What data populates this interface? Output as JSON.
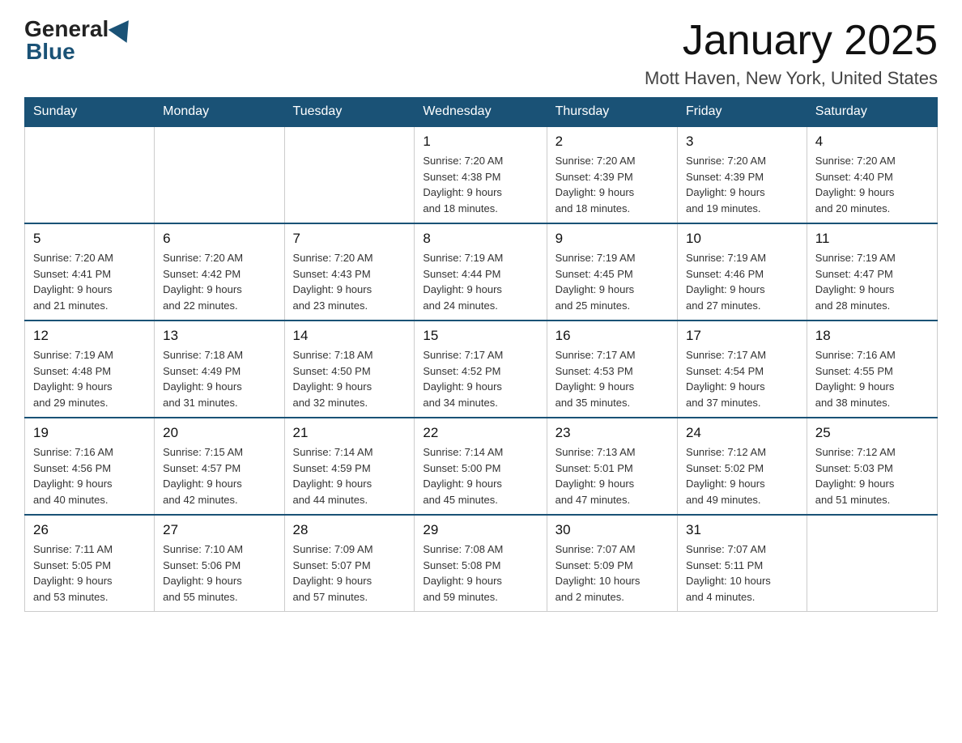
{
  "header": {
    "logo_general": "General",
    "logo_blue": "Blue",
    "month_title": "January 2025",
    "location": "Mott Haven, New York, United States"
  },
  "days_of_week": [
    "Sunday",
    "Monday",
    "Tuesday",
    "Wednesday",
    "Thursday",
    "Friday",
    "Saturday"
  ],
  "weeks": [
    [
      {
        "day": "",
        "info": ""
      },
      {
        "day": "",
        "info": ""
      },
      {
        "day": "",
        "info": ""
      },
      {
        "day": "1",
        "info": "Sunrise: 7:20 AM\nSunset: 4:38 PM\nDaylight: 9 hours\nand 18 minutes."
      },
      {
        "day": "2",
        "info": "Sunrise: 7:20 AM\nSunset: 4:39 PM\nDaylight: 9 hours\nand 18 minutes."
      },
      {
        "day": "3",
        "info": "Sunrise: 7:20 AM\nSunset: 4:39 PM\nDaylight: 9 hours\nand 19 minutes."
      },
      {
        "day": "4",
        "info": "Sunrise: 7:20 AM\nSunset: 4:40 PM\nDaylight: 9 hours\nand 20 minutes."
      }
    ],
    [
      {
        "day": "5",
        "info": "Sunrise: 7:20 AM\nSunset: 4:41 PM\nDaylight: 9 hours\nand 21 minutes."
      },
      {
        "day": "6",
        "info": "Sunrise: 7:20 AM\nSunset: 4:42 PM\nDaylight: 9 hours\nand 22 minutes."
      },
      {
        "day": "7",
        "info": "Sunrise: 7:20 AM\nSunset: 4:43 PM\nDaylight: 9 hours\nand 23 minutes."
      },
      {
        "day": "8",
        "info": "Sunrise: 7:19 AM\nSunset: 4:44 PM\nDaylight: 9 hours\nand 24 minutes."
      },
      {
        "day": "9",
        "info": "Sunrise: 7:19 AM\nSunset: 4:45 PM\nDaylight: 9 hours\nand 25 minutes."
      },
      {
        "day": "10",
        "info": "Sunrise: 7:19 AM\nSunset: 4:46 PM\nDaylight: 9 hours\nand 27 minutes."
      },
      {
        "day": "11",
        "info": "Sunrise: 7:19 AM\nSunset: 4:47 PM\nDaylight: 9 hours\nand 28 minutes."
      }
    ],
    [
      {
        "day": "12",
        "info": "Sunrise: 7:19 AM\nSunset: 4:48 PM\nDaylight: 9 hours\nand 29 minutes."
      },
      {
        "day": "13",
        "info": "Sunrise: 7:18 AM\nSunset: 4:49 PM\nDaylight: 9 hours\nand 31 minutes."
      },
      {
        "day": "14",
        "info": "Sunrise: 7:18 AM\nSunset: 4:50 PM\nDaylight: 9 hours\nand 32 minutes."
      },
      {
        "day": "15",
        "info": "Sunrise: 7:17 AM\nSunset: 4:52 PM\nDaylight: 9 hours\nand 34 minutes."
      },
      {
        "day": "16",
        "info": "Sunrise: 7:17 AM\nSunset: 4:53 PM\nDaylight: 9 hours\nand 35 minutes."
      },
      {
        "day": "17",
        "info": "Sunrise: 7:17 AM\nSunset: 4:54 PM\nDaylight: 9 hours\nand 37 minutes."
      },
      {
        "day": "18",
        "info": "Sunrise: 7:16 AM\nSunset: 4:55 PM\nDaylight: 9 hours\nand 38 minutes."
      }
    ],
    [
      {
        "day": "19",
        "info": "Sunrise: 7:16 AM\nSunset: 4:56 PM\nDaylight: 9 hours\nand 40 minutes."
      },
      {
        "day": "20",
        "info": "Sunrise: 7:15 AM\nSunset: 4:57 PM\nDaylight: 9 hours\nand 42 minutes."
      },
      {
        "day": "21",
        "info": "Sunrise: 7:14 AM\nSunset: 4:59 PM\nDaylight: 9 hours\nand 44 minutes."
      },
      {
        "day": "22",
        "info": "Sunrise: 7:14 AM\nSunset: 5:00 PM\nDaylight: 9 hours\nand 45 minutes."
      },
      {
        "day": "23",
        "info": "Sunrise: 7:13 AM\nSunset: 5:01 PM\nDaylight: 9 hours\nand 47 minutes."
      },
      {
        "day": "24",
        "info": "Sunrise: 7:12 AM\nSunset: 5:02 PM\nDaylight: 9 hours\nand 49 minutes."
      },
      {
        "day": "25",
        "info": "Sunrise: 7:12 AM\nSunset: 5:03 PM\nDaylight: 9 hours\nand 51 minutes."
      }
    ],
    [
      {
        "day": "26",
        "info": "Sunrise: 7:11 AM\nSunset: 5:05 PM\nDaylight: 9 hours\nand 53 minutes."
      },
      {
        "day": "27",
        "info": "Sunrise: 7:10 AM\nSunset: 5:06 PM\nDaylight: 9 hours\nand 55 minutes."
      },
      {
        "day": "28",
        "info": "Sunrise: 7:09 AM\nSunset: 5:07 PM\nDaylight: 9 hours\nand 57 minutes."
      },
      {
        "day": "29",
        "info": "Sunrise: 7:08 AM\nSunset: 5:08 PM\nDaylight: 9 hours\nand 59 minutes."
      },
      {
        "day": "30",
        "info": "Sunrise: 7:07 AM\nSunset: 5:09 PM\nDaylight: 10 hours\nand 2 minutes."
      },
      {
        "day": "31",
        "info": "Sunrise: 7:07 AM\nSunset: 5:11 PM\nDaylight: 10 hours\nand 4 minutes."
      },
      {
        "day": "",
        "info": ""
      }
    ]
  ]
}
